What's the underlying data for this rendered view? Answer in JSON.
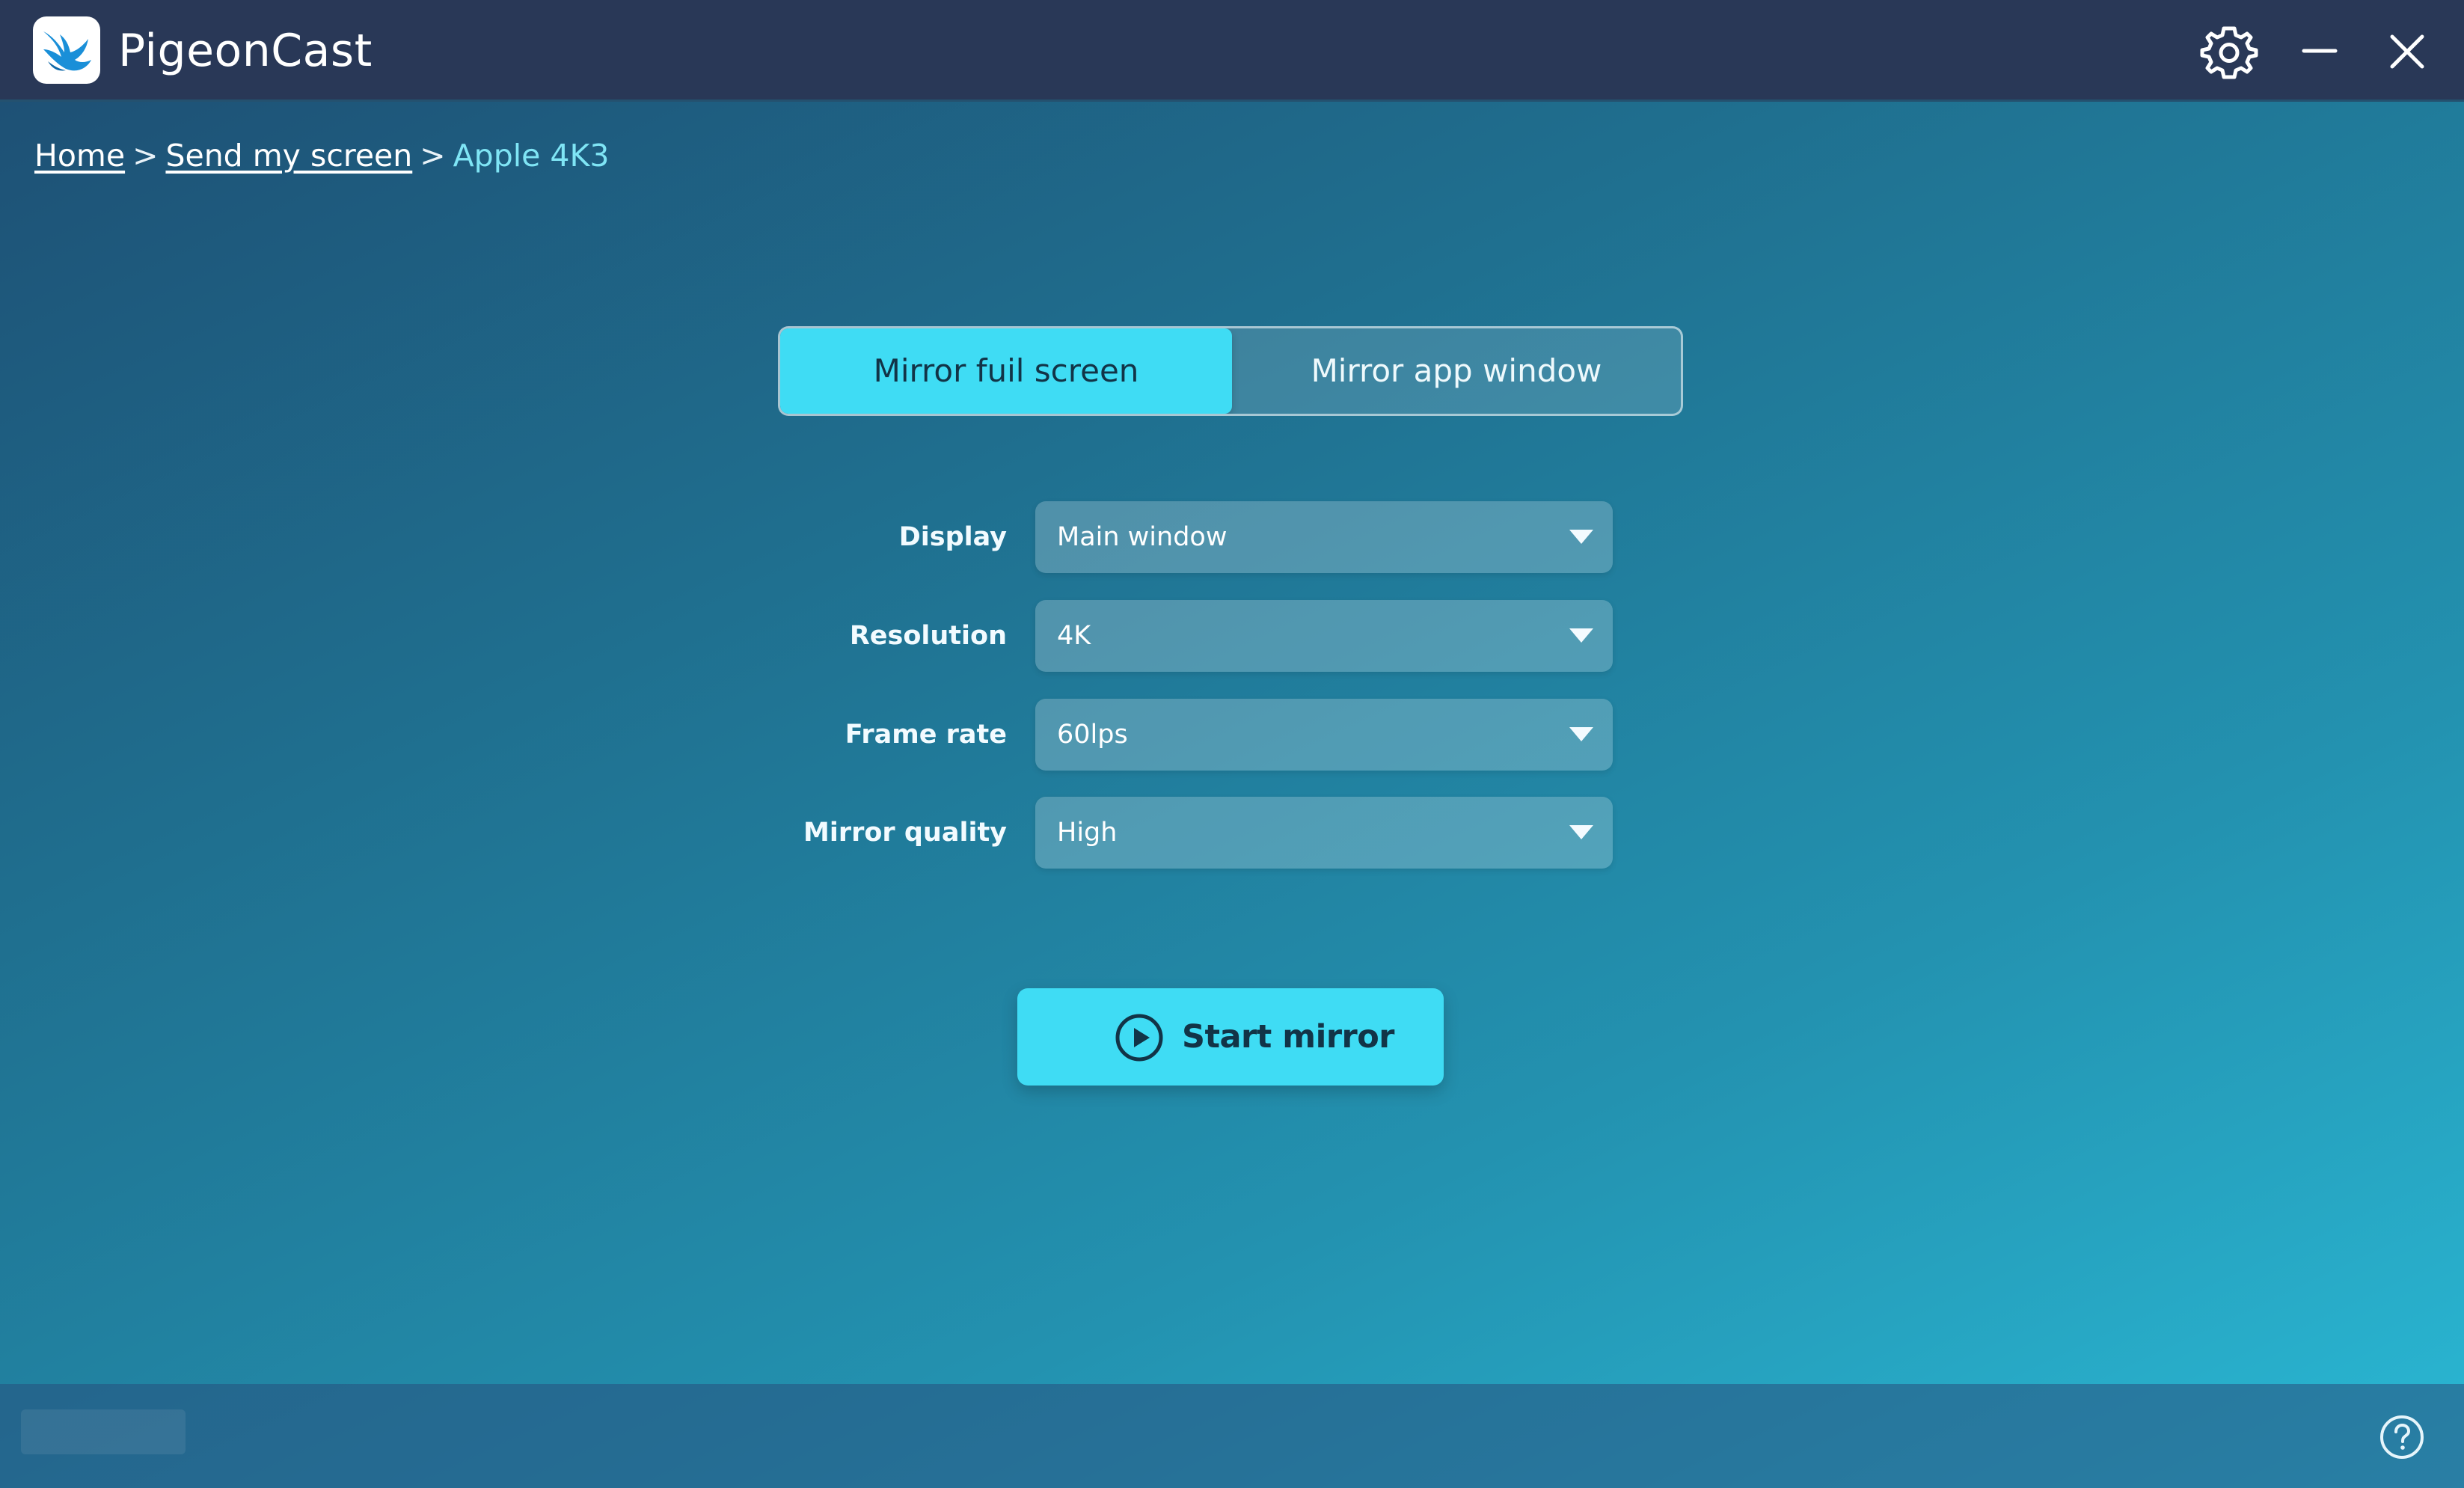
{
  "app": {
    "name": "PigeonCast",
    "logo_icon": "pigeon-logo-icon"
  },
  "titlebar": {
    "settings_icon": "gear-icon",
    "minimize_icon": "minimize-icon",
    "close_icon": "close-icon"
  },
  "breadcrumb": {
    "items": [
      {
        "label": "Home",
        "link": true
      },
      {
        "label": "Send my screen",
        "link": true
      },
      {
        "label": "Apple 4K3",
        "link": false
      }
    ],
    "separator": ">"
  },
  "mode_tabs": {
    "items": [
      {
        "label": "Mirror fuil screen",
        "selected": true
      },
      {
        "label": "Mirror app window",
        "selected": false
      }
    ]
  },
  "settings": {
    "display": {
      "label": "Display",
      "value": "Main window"
    },
    "resolution": {
      "label": "Resolution",
      "value": "4K"
    },
    "frame_rate": {
      "label": "Frame rate",
      "value": "60lps"
    },
    "mirror_quality": {
      "label": "Mirror quality",
      "value": "High"
    }
  },
  "start_button": {
    "label": "Start mirror",
    "icon": "play-circle-icon"
  },
  "footer": {
    "help_icon": "help-circle-icon"
  },
  "colors": {
    "titlebar": "#293857",
    "accent": "#3fdcf4",
    "breadcrumb_current": "#7fe5f5",
    "accent_text": "#123447"
  }
}
